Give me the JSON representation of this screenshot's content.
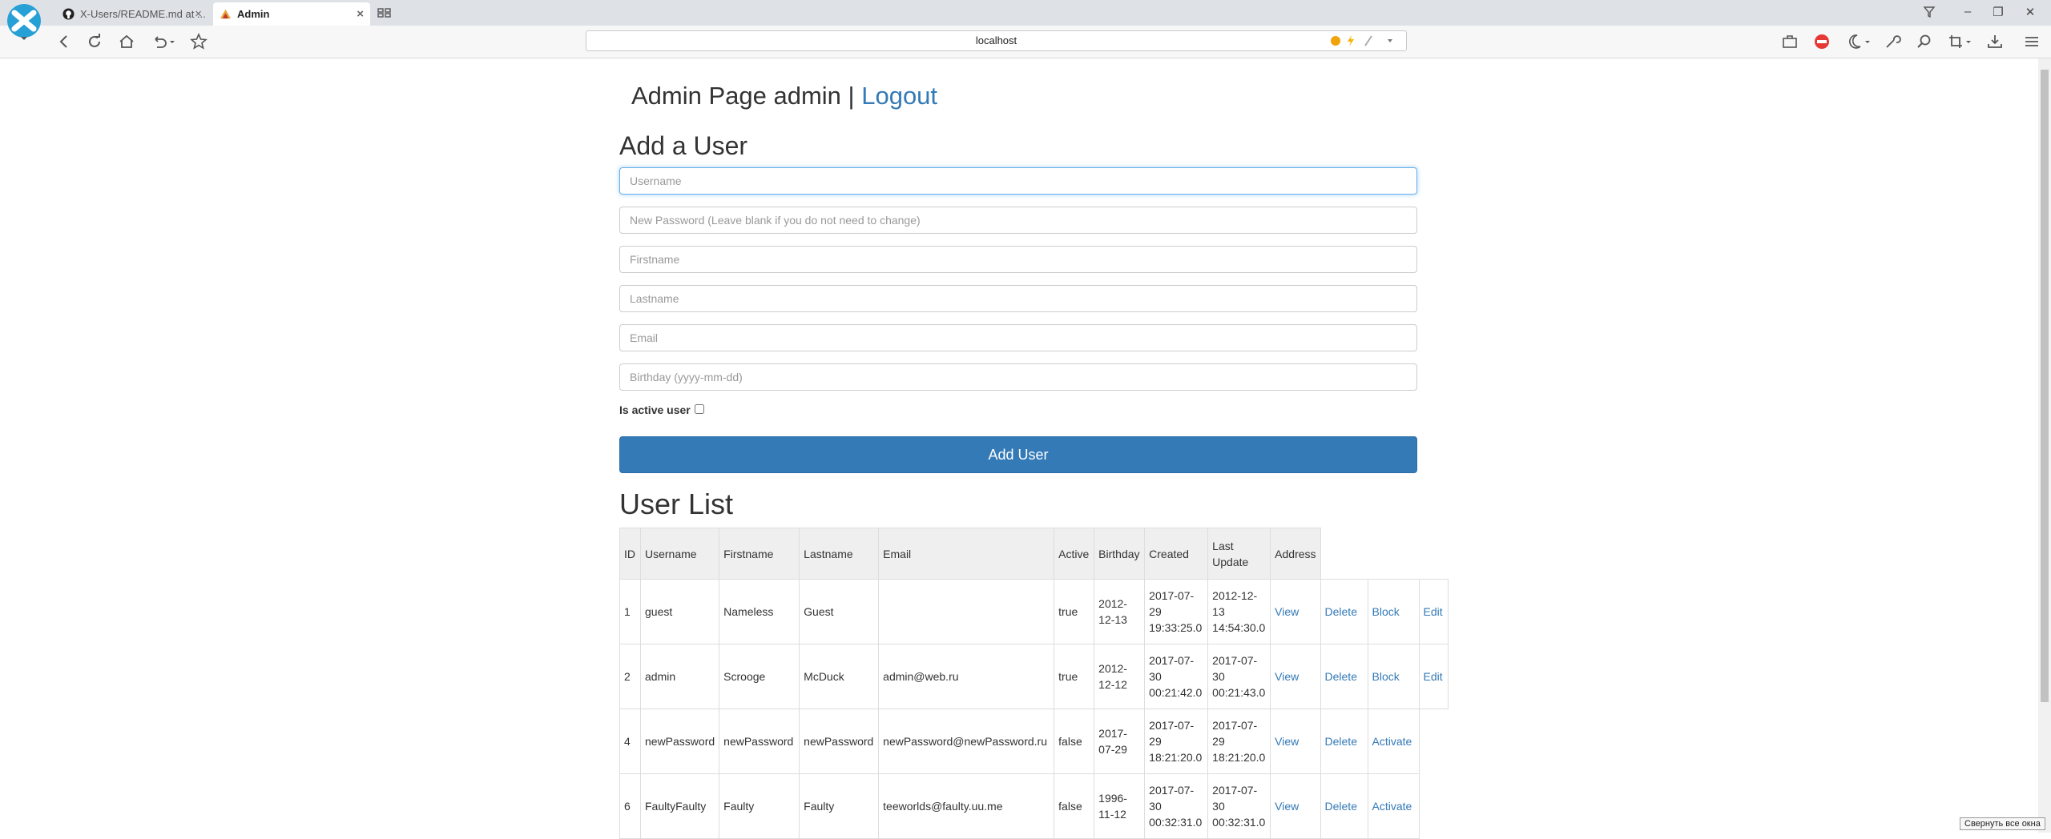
{
  "browser": {
    "tabs": [
      {
        "title": "X-Users/README.md at ...",
        "icon": "github-icon"
      },
      {
        "title": "Admin",
        "icon": "admin-favicon-icon"
      }
    ],
    "address": "localhost"
  },
  "header": {
    "title": "Admin Page admin |",
    "logout": "Logout"
  },
  "add_user": {
    "heading": "Add a User",
    "fields": {
      "username": "Username",
      "password": "New Password (Leave blank if you do not need to change)",
      "firstname": "Firstname",
      "lastname": "Lastname",
      "email": "Email",
      "birthday": "Birthday (yyyy-mm-dd)"
    },
    "active_label": "Is active user",
    "active_checked": false,
    "submit": "Add User"
  },
  "user_list": {
    "heading": "User List",
    "columns": [
      "ID",
      "Username",
      "Firstname",
      "Lastname",
      "Email",
      "Active",
      "Birthday",
      "Created",
      "Last Update",
      "Address"
    ],
    "rows": [
      {
        "id": "1",
        "username": "guest",
        "firstname": "Nameless",
        "lastname": "Guest",
        "email": "",
        "active": "true",
        "birthday": "2012-12-13",
        "created": "2017-07-29 19:33:25.0",
        "updated": "2012-12-13 14:54:30.0",
        "view": "View",
        "delete": "Delete",
        "toggle": "Block",
        "edit": "Edit"
      },
      {
        "id": "2",
        "username": "admin",
        "firstname": "Scrooge",
        "lastname": "McDuck",
        "email": "admin@web.ru",
        "active": "true",
        "birthday": "2012-12-12",
        "created": "2017-07-30 00:21:42.0",
        "updated": "2017-07-30 00:21:43.0",
        "view": "View",
        "delete": "Delete",
        "toggle": "Block",
        "edit": "Edit"
      },
      {
        "id": "4",
        "username": "newPassword",
        "firstname": "newPassword",
        "lastname": "newPassword",
        "email": "newPassword@newPassword.ru",
        "active": "false",
        "birthday": "2017-07-29",
        "created": "2017-07-29 18:21:20.0",
        "updated": "2017-07-29 18:21:20.0",
        "view": "View",
        "delete": "Delete",
        "toggle": "Activate",
        "edit": ""
      },
      {
        "id": "6",
        "username": "FaultyFaulty",
        "firstname": "Faulty",
        "lastname": "Faulty",
        "email": "teeworlds@faulty.uu.me",
        "active": "false",
        "birthday": "1996-11-12",
        "created": "2017-07-30 00:32:31.0",
        "updated": "2017-07-30 00:32:31.0",
        "view": "View",
        "delete": "Delete",
        "toggle": "Activate",
        "edit": ""
      }
    ]
  },
  "tooltip": "Свернуть все окна",
  "colors": {
    "link": "#337ab7",
    "button": "#337ab7",
    "chrome": "#dee1e6"
  }
}
